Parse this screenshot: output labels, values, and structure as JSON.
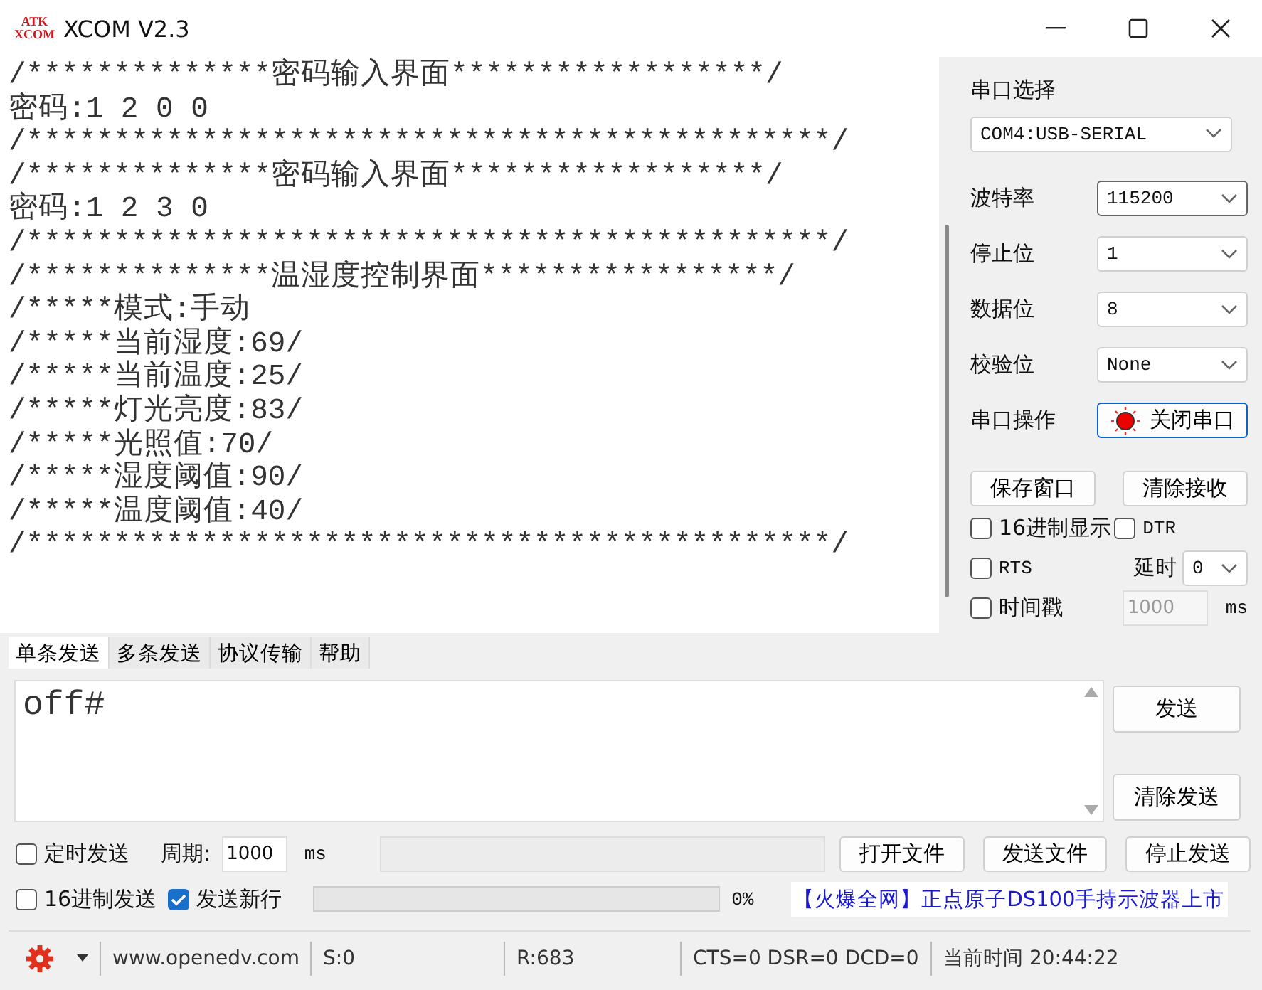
{
  "window": {
    "title": "XCOM V2.3",
    "logo": [
      "ATK",
      "XCOM"
    ]
  },
  "receive": {
    "lines": [
      "/**************密码输入界面******************/",
      "密码:1 2 0 0",
      "/**********************************************/",
      "/**************密码输入界面******************/",
      "密码:1 2 3 0",
      "/**********************************************/",
      "/**************温湿度控制界面*****************/",
      "/*****模式:手动",
      "/*****当前湿度:69/",
      "/*****当前温度:25/",
      "/*****灯光亮度:83/",
      "/*****光照值:70/",
      "/*****湿度阈值:90/",
      "/*****温度阈值:40/",
      "/**********************************************/"
    ]
  },
  "serial": {
    "port_label": "串口选择",
    "port": "COM4:USB-SERIAL",
    "settings": [
      {
        "label": "波特率",
        "value": "115200",
        "focused": true
      },
      {
        "label": "停止位",
        "value": "1",
        "focused": false
      },
      {
        "label": "数据位",
        "value": "8",
        "focused": false
      },
      {
        "label": "校验位",
        "value": "None",
        "focused": false
      }
    ],
    "operation_label": "串口操作",
    "toggle_button": "关闭串口",
    "open": true,
    "save_button": "保存窗口",
    "clear_button": "清除接收",
    "hex_display": {
      "label": "16进制显示",
      "checked": false
    },
    "dtr": {
      "label": "DTR",
      "checked": false
    },
    "rts": {
      "label": "RTS",
      "checked": false
    },
    "delay_label": "延时",
    "delay": "0",
    "timestamp": {
      "label": "时间戳",
      "checked": false,
      "interval": "1000",
      "unit": "ms"
    }
  },
  "tabs": [
    {
      "label": "单条发送",
      "selected": true
    },
    {
      "label": "多条发送",
      "selected": false
    },
    {
      "label": "协议传输",
      "selected": false
    },
    {
      "label": "帮助",
      "selected": false
    }
  ],
  "send": {
    "text": "off#",
    "send_button": "发送",
    "clear_button": "清除发送"
  },
  "timer": {
    "label": "定时发送",
    "checked": false,
    "period_label": "周期:",
    "period": "1000",
    "unit": "ms"
  },
  "file_buttons": [
    "打开文件",
    "发送文件",
    "停止发送"
  ],
  "hex_send": {
    "label": "16进制发送",
    "checked": false
  },
  "newline": {
    "label": "发送新行",
    "checked": true
  },
  "progress": {
    "level": 0,
    "reading": "0%"
  },
  "ad": "【火爆全网】正点原子DS100手持示波器上市",
  "status_bar": {
    "website": "www.openedv.com",
    "sent": "S:0",
    "received": "R:683",
    "signals": "CTS=0 DSR=0 DCD=0",
    "time": "当前时间 20:44:22"
  }
}
